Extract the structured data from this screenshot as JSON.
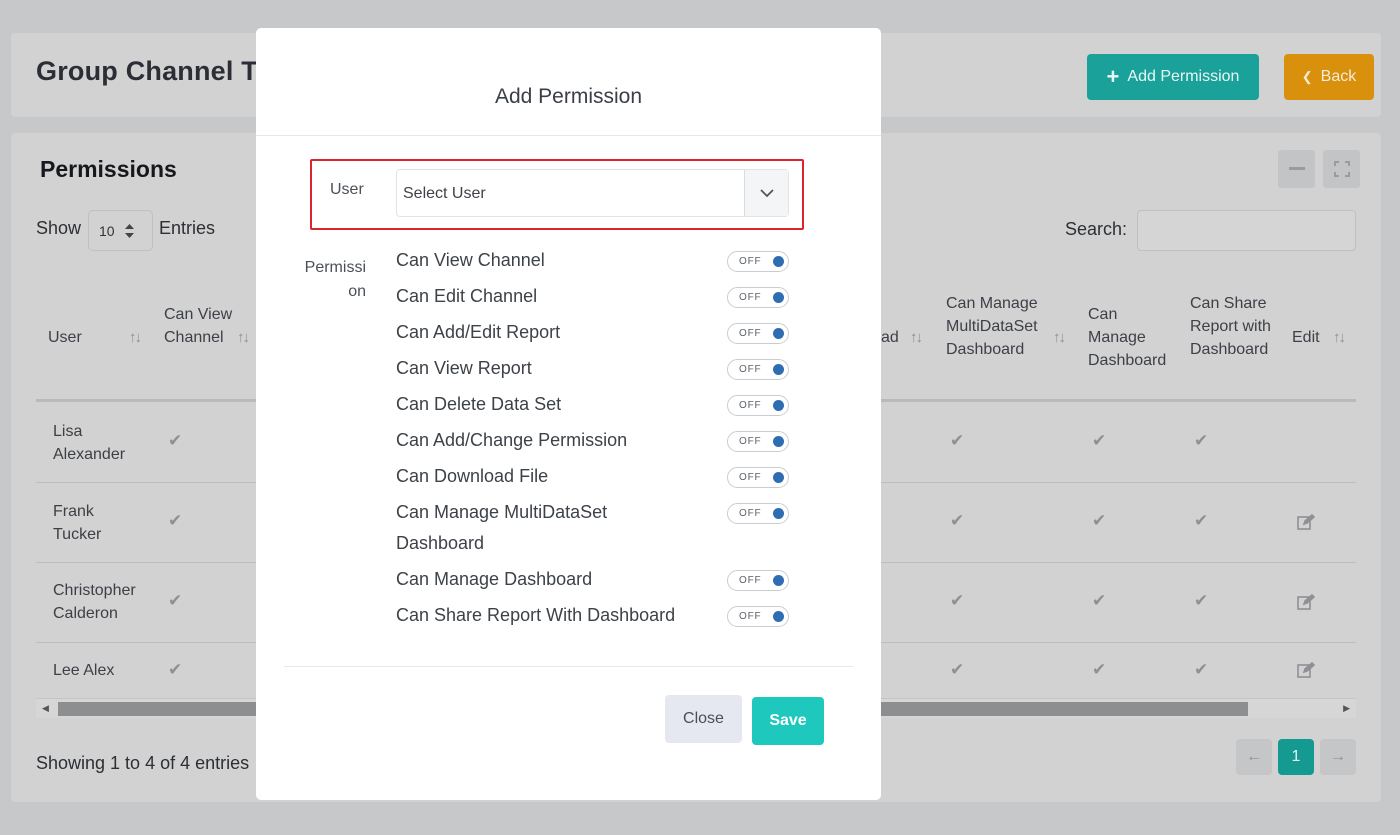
{
  "page": {
    "title": "Group Channel Te",
    "add_permission_label": "Add Permission",
    "back_label": "Back"
  },
  "permissions_card": {
    "title": "Permissions",
    "show_label": "Show",
    "entries_value": "10",
    "entries_label": "Entries",
    "search_label": "Search:",
    "columns": [
      {
        "label": "User"
      },
      {
        "label": "Can View Channel"
      },
      {
        "label": "ad"
      },
      {
        "label": "Can Manage MultiDataSet Dashboard"
      },
      {
        "label": "Can Manage Dashboard"
      },
      {
        "label": "Can Share Report with Dashboard"
      },
      {
        "label": "Edit"
      }
    ],
    "rows": [
      {
        "user": "Lisa Alexander"
      },
      {
        "user": "Frank Tucker"
      },
      {
        "user": "Christopher Calderon"
      },
      {
        "user": "Lee Alex"
      }
    ],
    "showing_text": "Showing 1 to 4 of 4 entries",
    "current_page": "1"
  },
  "modal": {
    "title": "Add Permission",
    "user_label": "User",
    "user_select_value": "Select User",
    "permission_label": "Permission",
    "toggle_text": "OFF",
    "permissions": [
      {
        "label": "Can View Channel"
      },
      {
        "label": "Can Edit Channel"
      },
      {
        "label": "Can Add/Edit Report"
      },
      {
        "label": "Can View Report"
      },
      {
        "label": "Can Delete Data Set"
      },
      {
        "label": "Can Add/Change Permission"
      },
      {
        "label": "Can Download File"
      },
      {
        "label": "Can Manage MultiDataSet Dashboard"
      },
      {
        "label": "Can Manage Dashboard"
      },
      {
        "label": "Can Share Report With Dashboard"
      }
    ],
    "close_label": "Close",
    "save_label": "Save"
  },
  "colors": {
    "accent_teal": "#1aa19a",
    "back_orange": "#d9900c",
    "save_teal": "#1ec8bd",
    "highlight_red": "#d9262e",
    "toggle_knob": "#2f6db3"
  }
}
